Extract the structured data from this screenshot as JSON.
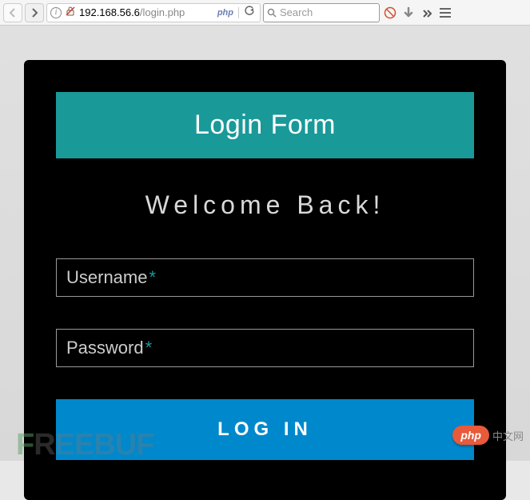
{
  "browser": {
    "url_host": "192.168.56.6",
    "url_path": "/login.php",
    "php_badge": "php",
    "search_placeholder": "Search"
  },
  "form": {
    "title": "Login Form",
    "welcome": "Welcome Back!",
    "username_label": "Username",
    "password_label": "Password",
    "required_mark": "*",
    "submit_label": "LOG IN"
  },
  "watermarks": {
    "left": "REEBUF",
    "php_logo": "php",
    "cn_text": "中文网"
  }
}
